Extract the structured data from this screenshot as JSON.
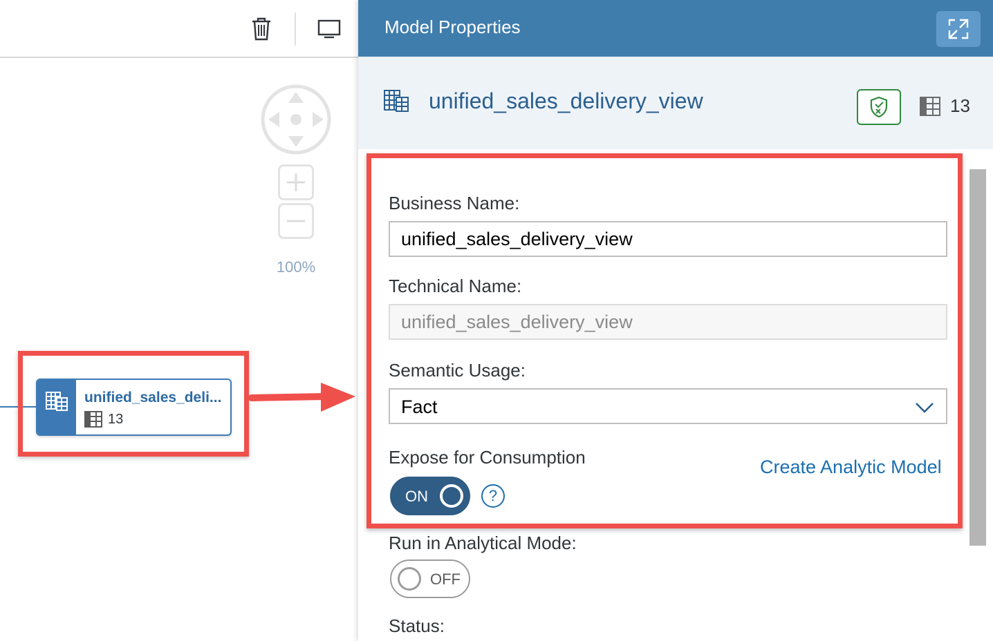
{
  "toolbar": {
    "delete_icon": "trash-icon",
    "monitor_icon": "monitor-icon"
  },
  "canvas": {
    "zoom_level": "100%",
    "node": {
      "title": "unified_sales_deli...",
      "column_count": "13",
      "icon": "table-view-icon"
    }
  },
  "panel": {
    "title": "Model Properties",
    "object": {
      "name": "unified_sales_delivery_view",
      "column_count": "13"
    },
    "form": {
      "business_name_label": "Business Name:",
      "business_name_value": "unified_sales_delivery_view",
      "technical_name_label": "Technical Name:",
      "technical_name_value": "unified_sales_delivery_view",
      "semantic_usage_label": "Semantic Usage:",
      "semantic_usage_value": "Fact",
      "expose_label": "Expose for Consumption",
      "expose_state": "ON",
      "create_link": "Create Analytic Model",
      "help_glyph": "?",
      "analytical_label": "Run in Analytical Mode:",
      "analytical_state": "OFF",
      "status_label": "Status:"
    }
  },
  "colors": {
    "header_blue": "#3f7dad",
    "highlight_red": "#f0504b",
    "link_blue": "#1a6fb0",
    "toggle_on": "#2f5d86"
  }
}
